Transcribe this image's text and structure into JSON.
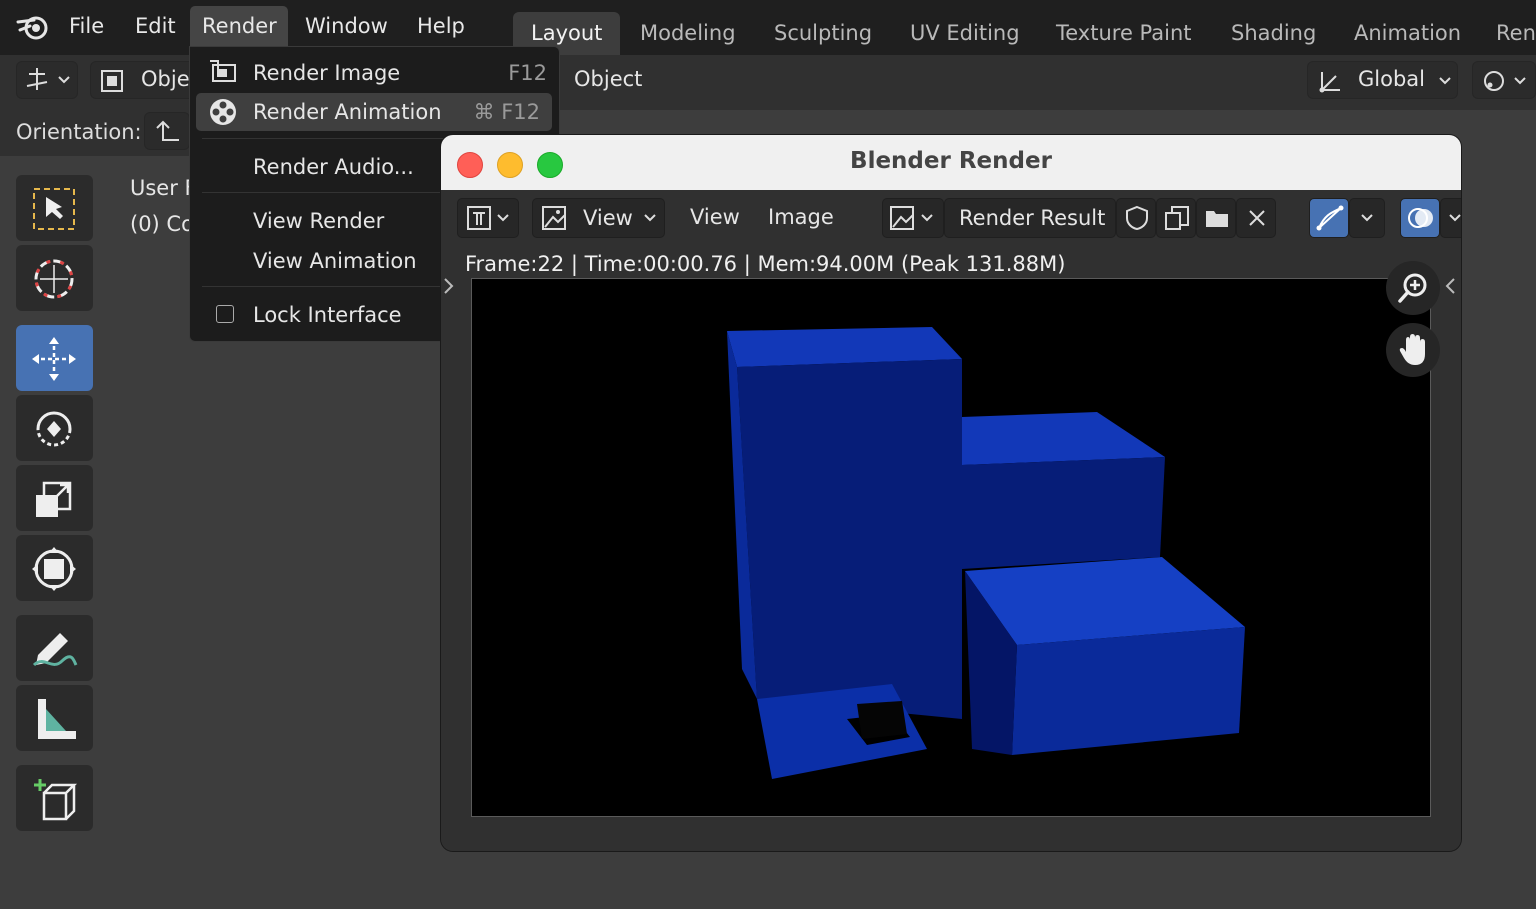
{
  "menubar": {
    "items": [
      "File",
      "Edit",
      "Render",
      "Window",
      "Help"
    ],
    "active": "Render"
  },
  "workspaces": [
    "Layout",
    "Modeling",
    "Sculpting",
    "UV Editing",
    "Texture Paint",
    "Shading",
    "Animation",
    "Ren"
  ],
  "workspace_active": "Layout",
  "header": {
    "mode_label": "Obje",
    "object_menu": "Object",
    "orientation_label": "Global"
  },
  "tool_settings": {
    "orientation_label": "Orientation:"
  },
  "viewport_overlay": {
    "line1": "User F",
    "line2": "(0) Co"
  },
  "render_menu": {
    "items": [
      {
        "label": "Render Image",
        "shortcut": "F12",
        "icon": "render-image-icon"
      },
      {
        "label": "Render Animation",
        "shortcut": "⌘ F12",
        "icon": "render-animation-icon"
      },
      {
        "label": "Render Audio...",
        "shortcut": ""
      },
      {
        "label": "View Render",
        "shortcut": ""
      },
      {
        "label": "View Animation",
        "shortcut": ""
      },
      {
        "label": "Lock Interface",
        "shortcut": "",
        "checkbox": false
      }
    ]
  },
  "render_window": {
    "title": "Blender Render",
    "view_menu": "View",
    "view_label": "View",
    "image_label": "Image",
    "image_name": "Render Result",
    "stats": "Frame:22 | Time:00:00.76 | Mem:94.00M (Peak 131.88M)"
  },
  "colors": {
    "accent": "#4772b3",
    "close": "#ff5f57",
    "minimize": "#febc2e",
    "zoom": "#28c840",
    "object_blue": "#0b2fa8"
  }
}
